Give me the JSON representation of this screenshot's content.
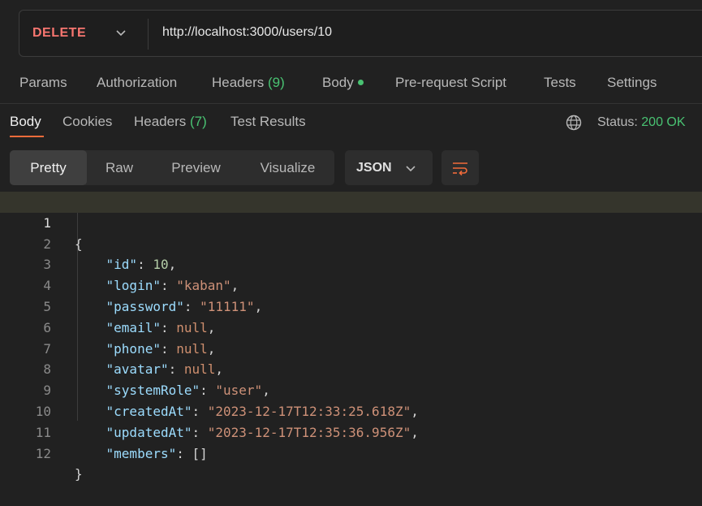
{
  "request": {
    "method": "DELETE",
    "url": "http://localhost:3000/users/10"
  },
  "request_tabs": {
    "params": "Params",
    "authorization": "Authorization",
    "headers": "Headers",
    "headers_count": "(9)",
    "body": "Body",
    "pre_request": "Pre-request Script",
    "tests": "Tests",
    "settings": "Settings"
  },
  "response_tabs": {
    "body": "Body",
    "cookies": "Cookies",
    "headers": "Headers",
    "headers_count": "(7)",
    "test_results": "Test Results"
  },
  "status": {
    "label": "Status:",
    "value": "200 OK"
  },
  "view_modes": {
    "pretty": "Pretty",
    "raw": "Raw",
    "preview": "Preview",
    "visualize": "Visualize"
  },
  "format": {
    "selected": "JSON"
  },
  "colors": {
    "method": "#f87670",
    "ok": "#49c272",
    "accent": "#f26b3a"
  },
  "code_lines": [
    "1",
    "2",
    "3",
    "4",
    "5",
    "6",
    "7",
    "8",
    "9",
    "10",
    "11",
    "12"
  ],
  "response_body": {
    "open": "{",
    "close": "}",
    "fields": [
      {
        "key": "\"id\"",
        "value": "10",
        "type": "number"
      },
      {
        "key": "\"login\"",
        "value": "\"kaban\"",
        "type": "string"
      },
      {
        "key": "\"password\"",
        "value": "\"11111\"",
        "type": "string"
      },
      {
        "key": "\"email\"",
        "value": "null",
        "type": "null"
      },
      {
        "key": "\"phone\"",
        "value": "null",
        "type": "null"
      },
      {
        "key": "\"avatar\"",
        "value": "null",
        "type": "null"
      },
      {
        "key": "\"systemRole\"",
        "value": "\"user\"",
        "type": "string"
      },
      {
        "key": "\"createdAt\"",
        "value": "\"2023-12-17T12:33:25.618Z\"",
        "type": "string"
      },
      {
        "key": "\"updatedAt\"",
        "value": "\"2023-12-17T12:35:36.956Z\"",
        "type": "string"
      },
      {
        "key": "\"members\"",
        "value": "[]",
        "type": "array"
      }
    ]
  }
}
